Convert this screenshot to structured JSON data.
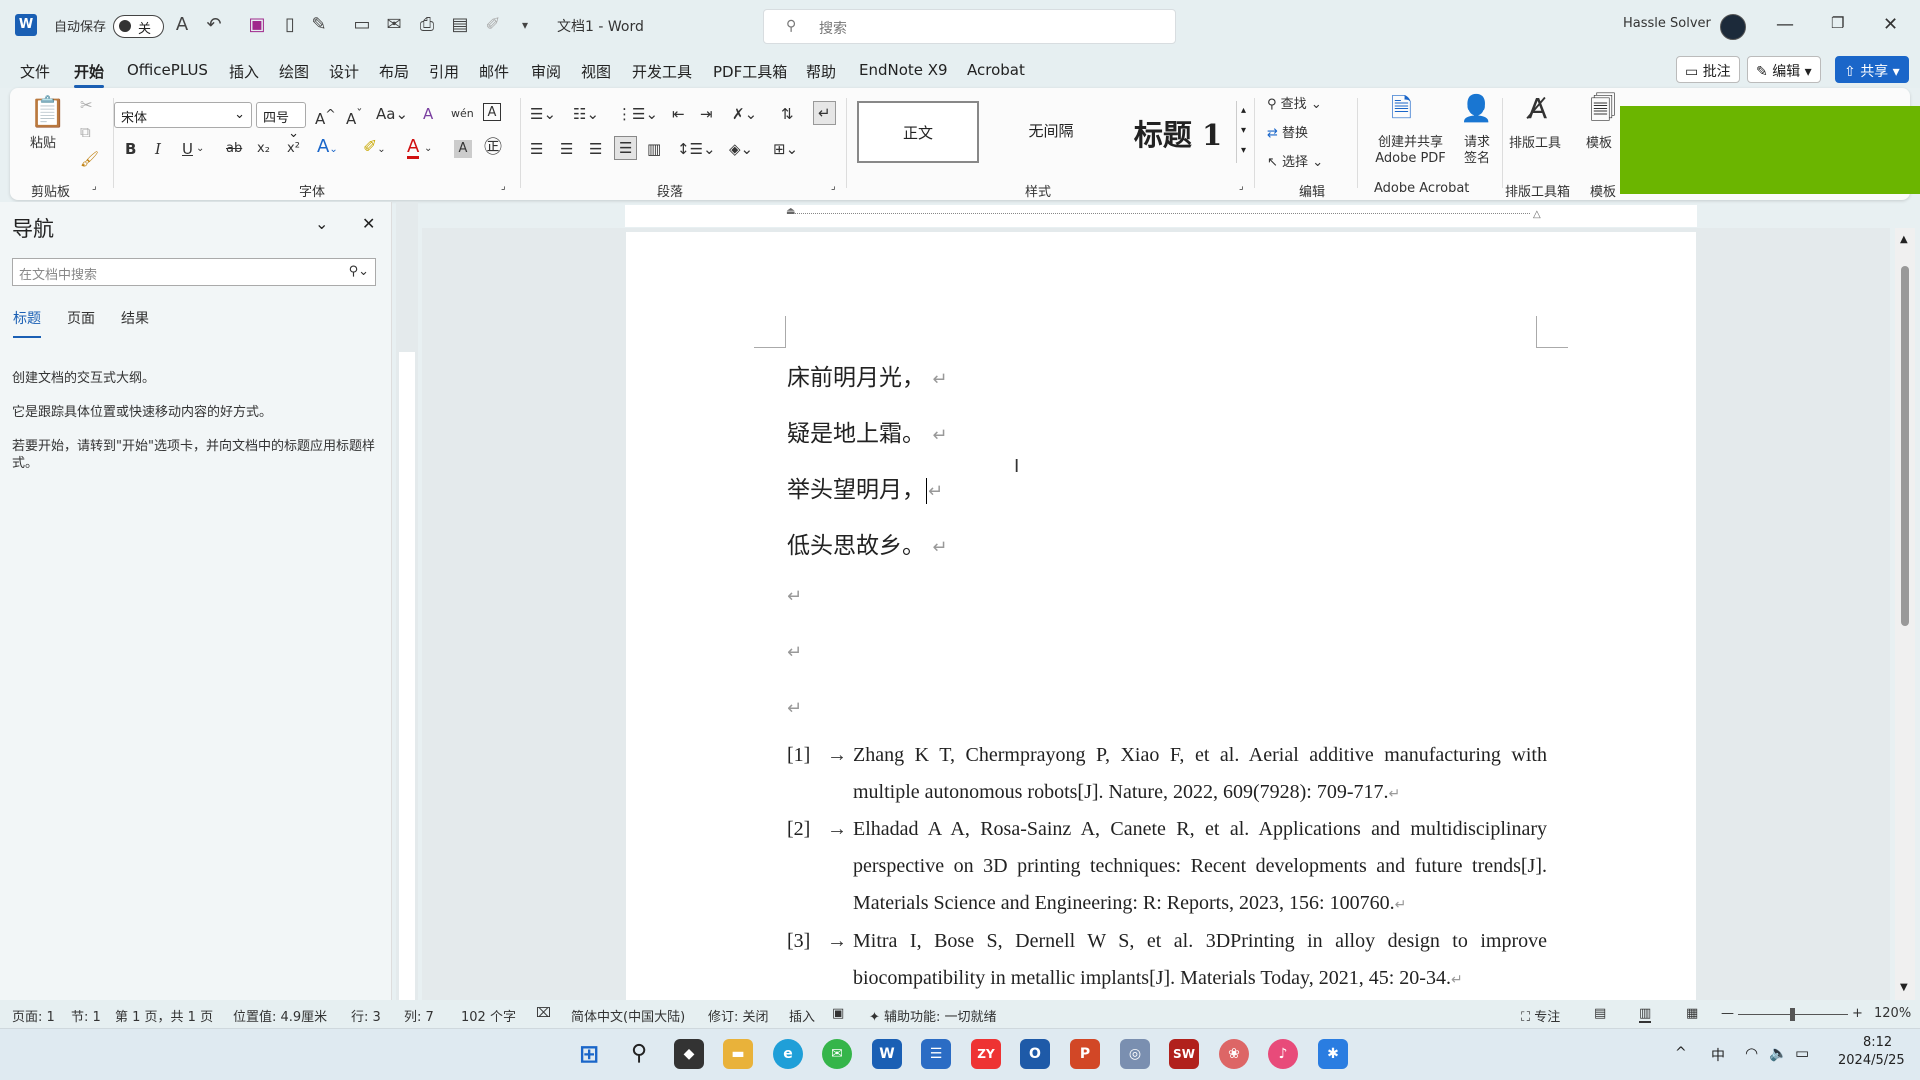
{
  "titlebar": {
    "autosave_label": "自动保存",
    "autosave_state": "关",
    "doc_title": "文档1 - Word",
    "search_placeholder": "搜索",
    "user": "Hassle Solver"
  },
  "menu": {
    "tabs": [
      "文件",
      "开始",
      "OfficePLUS",
      "插入",
      "绘图",
      "设计",
      "布局",
      "引用",
      "邮件",
      "审阅",
      "视图",
      "开发工具",
      "PDF工具箱",
      "帮助",
      "EndNote X9",
      "Acrobat"
    ],
    "active": "开始",
    "comment_btn": "批注",
    "edit_btn": "编辑",
    "share_btn": "共享"
  },
  "ribbon": {
    "groups": {
      "clipboard": "剪贴板",
      "font": "字体",
      "paragraph": "段落",
      "styles": "样式",
      "editing": "编辑",
      "acrobat": "Adobe Acrobat",
      "typeset": "排版工具箱",
      "template": "模板"
    },
    "paste": "粘贴",
    "font_name": "宋体",
    "font_size": "四号",
    "font_btns": [
      "B",
      "I",
      "U",
      "ab",
      "x₂",
      "x²"
    ],
    "styles": {
      "normal": "正文",
      "nospace": "无间隔",
      "heading1": "标题 1"
    },
    "editing": {
      "find": "查找",
      "replace": "替换",
      "select": "选择"
    },
    "acrobat": {
      "create": "创建并共享 Adobe PDF",
      "sign": "请求签名"
    },
    "typeset_tool": "排版工具",
    "template_lbl": "模板"
  },
  "nav": {
    "title": "导航",
    "search_placeholder": "在文档中搜索",
    "tabs": [
      "标题",
      "页面",
      "结果"
    ],
    "active_tab": "标题",
    "p1": "创建文档的交互式大纲。",
    "p2": "它是跟踪具体位置或快速移动内容的好方式。",
    "p3": "若要开始，请转到\"开始\"选项卡，并向文档中的标题应用标题样式。"
  },
  "doc": {
    "lines": [
      "床前明月光，",
      "疑是地上霜。",
      "举头望明月，",
      "低头思故乡。"
    ],
    "references": [
      {
        "num": "[1]",
        "text": "Zhang K T, Chermprayong P, Xiao F, et al. Aerial additive manufacturing with multiple autonomous robots[J]. Nature, 2022, 609(7928): 709-717."
      },
      {
        "num": "[2]",
        "text": "Elhadad A A, Rosa-Sainz A, Canete R, et al. Applications and multidisciplinary perspective on 3D printing techniques: Recent developments and future trends[J]. Materials Science and Engineering: R: Reports, 2023, 156: 100760."
      },
      {
        "num": "[3]",
        "text": "Mitra I, Bose S, Dernell W S, et al. 3DPrinting in alloy design to improve biocompatibility in metallic implants[J]. Materials Today, 2021, 45: 20-34."
      }
    ]
  },
  "status": {
    "page": "页面: 1",
    "section": "节: 1",
    "pages": "第 1 页，共 1 页",
    "position": "位置值: 4.9厘米",
    "row": "行: 3",
    "col": "列: 7",
    "words": "102 个字",
    "lang": "简体中文(中国大陆)",
    "track": "修订: 关闭",
    "insert": "插入",
    "access": "辅助功能: 一切就绪",
    "focus": "专注",
    "zoom": "120%"
  },
  "taskbar": {
    "time": "8:12",
    "date": "2024/5/25",
    "ime": "中"
  }
}
